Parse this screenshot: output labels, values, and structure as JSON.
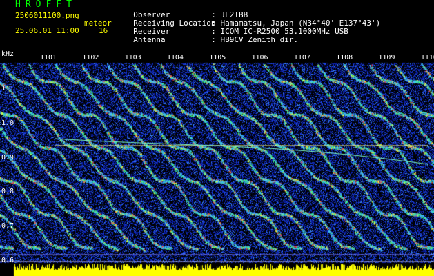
{
  "header": {
    "title": "HROFFT",
    "filename": "2506011100.png",
    "datetime": "25.06.01 11:00",
    "meteor_label": "meteor",
    "meteor_count": "16",
    "info": [
      {
        "key": "Observer",
        "sep": ":",
        "value": "JL2TBB"
      },
      {
        "key": "Receiving Location",
        "sep": ":",
        "value": "Hamamatsu, Japan (N34°40' E137°43')"
      },
      {
        "key": "Receiver",
        "sep": ":",
        "value": "ICOM IC-R2500 53.1000MHz USB"
      },
      {
        "key": "Antenna",
        "sep": ":",
        "value": "HB9CV Zenith dir."
      }
    ]
  },
  "axis": {
    "y_unit": "kHz",
    "y_ticks": [
      "1.1",
      "1.0",
      "0.9",
      "0.8",
      "0.7",
      "0.6"
    ],
    "x_ticks": [
      "1101",
      "1102",
      "1103",
      "1104",
      "1105",
      "1106",
      "1107",
      "1108",
      "1109",
      "1110"
    ]
  },
  "colors": {
    "background": "#000000",
    "header_yellow": "#ffff00",
    "title_green": "#00ff00",
    "spectrogram_blue": "#1030c0",
    "signal_line": "#ffff80",
    "bottom_band": "#ffff00"
  }
}
